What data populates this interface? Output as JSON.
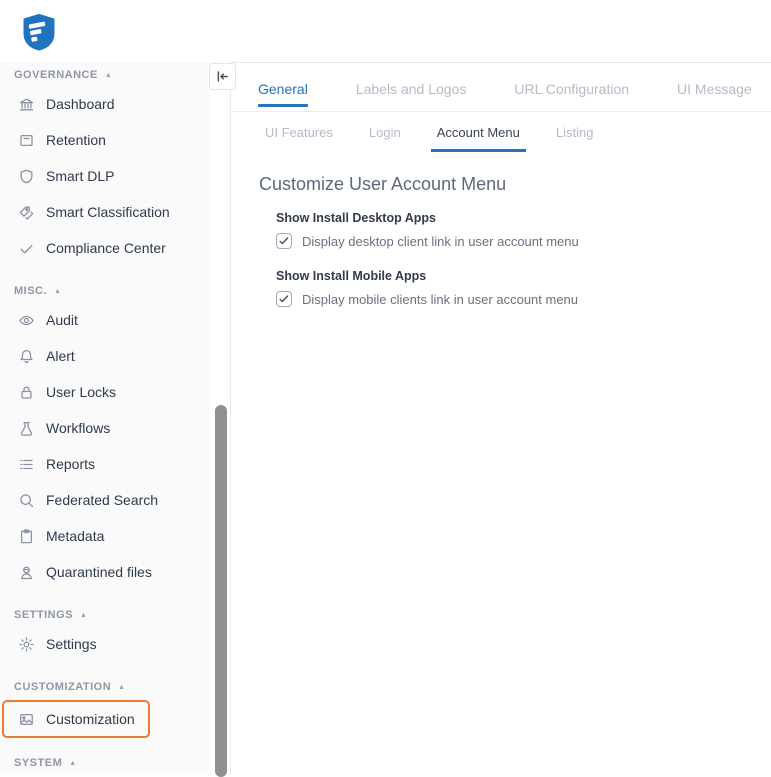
{
  "brand": {
    "logo_icon": "shield-logo-icon"
  },
  "colors": {
    "accent_blue": "#2574bb",
    "highlight_orange": "#e97c34",
    "logo_blue": "#2173bd"
  },
  "sidebar": {
    "sections": [
      {
        "label": "GOVERNANCE",
        "collapse_icon": "triangle-up-icon",
        "items": [
          {
            "icon": "bank-icon",
            "label": "Dashboard"
          },
          {
            "icon": "archive-icon",
            "label": "Retention"
          },
          {
            "icon": "shield-icon",
            "label": "Smart DLP"
          },
          {
            "icon": "tags-icon",
            "label": "Smart Classification"
          },
          {
            "icon": "check-icon",
            "label": "Compliance Center"
          }
        ]
      },
      {
        "label": "MISC.",
        "collapse_icon": "triangle-up-icon",
        "items": [
          {
            "icon": "eye-icon",
            "label": "Audit"
          },
          {
            "icon": "bell-icon",
            "label": "Alert"
          },
          {
            "icon": "lock-icon",
            "label": "User Locks"
          },
          {
            "icon": "flask-icon",
            "label": "Workflows"
          },
          {
            "icon": "list-icon",
            "label": "Reports"
          },
          {
            "icon": "search-icon",
            "label": "Federated Search"
          },
          {
            "icon": "clipboard-icon",
            "label": "Metadata"
          },
          {
            "icon": "quarantine-icon",
            "label": "Quarantined files"
          }
        ]
      },
      {
        "label": "SETTINGS",
        "collapse_icon": "triangle-up-icon",
        "items": [
          {
            "icon": "gear-icon",
            "label": "Settings"
          }
        ]
      },
      {
        "label": "CUSTOMIZATION",
        "collapse_icon": "triangle-up-icon",
        "items": [
          {
            "icon": "image-icon",
            "label": "Customization",
            "highlighted": true
          }
        ]
      },
      {
        "label": "SYSTEM",
        "collapse_icon": "triangle-up-icon",
        "items": []
      }
    ]
  },
  "main": {
    "collapse_button_icon": "collapse-panel-icon",
    "tabs": [
      {
        "label": "General",
        "active": true
      },
      {
        "label": "Labels and Logos",
        "active": false
      },
      {
        "label": "URL Configuration",
        "active": false
      },
      {
        "label": "UI Message",
        "active": false
      }
    ],
    "subtabs": [
      {
        "label": "UI Features",
        "active": false
      },
      {
        "label": "Login",
        "active": false
      },
      {
        "label": "Account Menu",
        "active": true
      },
      {
        "label": "Listing",
        "active": false
      }
    ],
    "heading": "Customize User Account Menu",
    "groups": [
      {
        "label": "Show Install Desktop Apps",
        "checkbox": {
          "checked": true,
          "label": "Display desktop client link in user account menu"
        }
      },
      {
        "label": "Show Install Mobile Apps",
        "checkbox": {
          "checked": true,
          "label": "Display mobile clients link in user account menu"
        }
      }
    ]
  }
}
